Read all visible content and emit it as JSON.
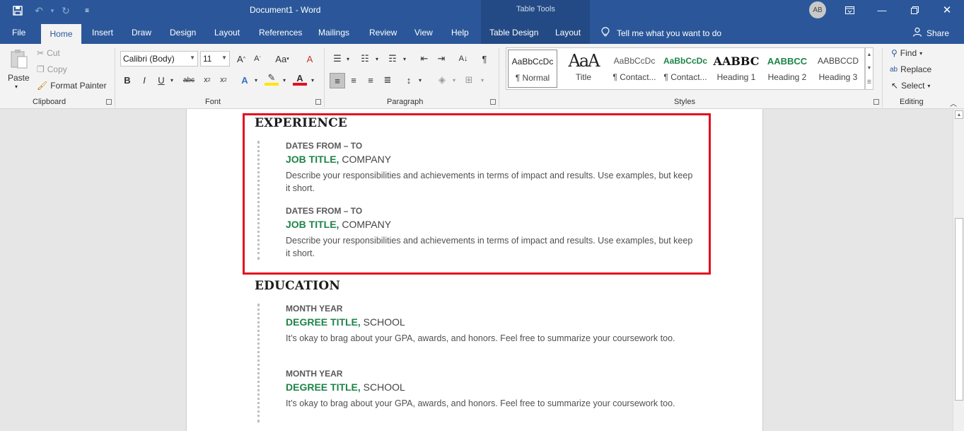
{
  "titlebar": {
    "doc_title": "Document1  -  Word",
    "context_label": "Table Tools",
    "avatar_initials": "AB"
  },
  "tabs": {
    "file": "File",
    "home": "Home",
    "insert": "Insert",
    "draw": "Draw",
    "design": "Design",
    "layout": "Layout",
    "references": "References",
    "mailings": "Mailings",
    "review": "Review",
    "view": "View",
    "help": "Help",
    "table_design": "Table Design",
    "table_layout": "Layout",
    "tell_me": "Tell me what you want to do",
    "share": "Share"
  },
  "ribbon": {
    "clipboard": {
      "paste": "Paste",
      "cut": "Cut",
      "copy": "Copy",
      "format_painter": "Format Painter",
      "label": "Clipboard"
    },
    "font": {
      "font_name": "Calibri (Body)",
      "font_size": "11",
      "label": "Font"
    },
    "paragraph": {
      "label": "Paragraph"
    },
    "styles": {
      "label": "Styles",
      "items": [
        {
          "preview": "AaBbCcDc",
          "name": "¶ Normal"
        },
        {
          "preview": "AaA",
          "name": "Title"
        },
        {
          "preview": "AaBbCcDc",
          "name": "¶ Contact..."
        },
        {
          "preview": "AaBbCcDc",
          "name": "¶ Contact..."
        },
        {
          "preview": "AABBC",
          "name": "Heading 1"
        },
        {
          "preview": "AABBCC",
          "name": "Heading 2"
        },
        {
          "preview": "AABBCCD",
          "name": "Heading 3"
        }
      ]
    },
    "editing": {
      "find": "Find",
      "replace": "Replace",
      "select": "Select",
      "label": "Editing"
    }
  },
  "document": {
    "experience": {
      "heading": "EXPERIENCE",
      "entries": [
        {
          "dates": "DATES FROM – TO",
          "job_title": "JOB TITLE,",
          "company": " COMPANY",
          "description": "Describe your responsibilities and achievements in terms of impact and results. Use examples, but keep it short."
        },
        {
          "dates": "DATES FROM – TO",
          "job_title": "JOB TITLE,",
          "company": " COMPANY",
          "description": "Describe your responsibilities and achievements in terms of impact and results. Use examples, but keep it short."
        }
      ]
    },
    "education": {
      "heading": "EDUCATION",
      "entries": [
        {
          "dates": "MONTH YEAR",
          "degree": "DEGREE TITLE,",
          "school": " SCHOOL",
          "description": "It’s okay to brag about your GPA, awards, and honors. Feel free to summarize your coursework too."
        },
        {
          "dates": "MONTH YEAR",
          "degree": "DEGREE TITLE,",
          "school": " SCHOOL",
          "description": "It’s okay to brag about your GPA, awards, and honors. Feel free to summarize your coursework too."
        }
      ]
    }
  },
  "colors": {
    "word_blue": "#2b579a",
    "job_title_green": "#1e8449",
    "highlight_red": "#e3101f"
  }
}
